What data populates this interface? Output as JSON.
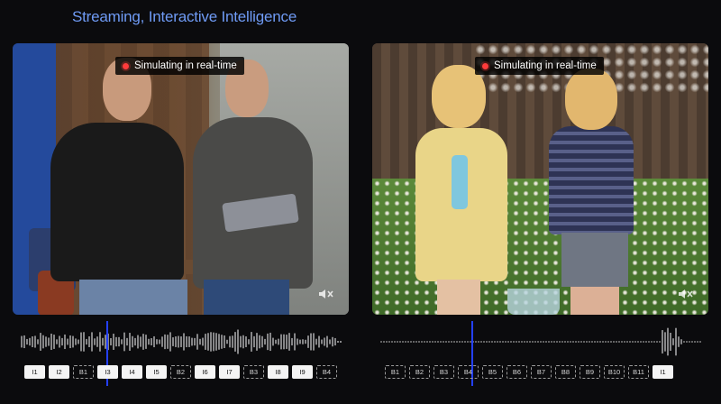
{
  "header": {
    "title": "Streaming, Interactive Intelligence"
  },
  "panels": [
    {
      "badge_text": "Simulating in real-time",
      "mute_icon": "speaker-muted-icon"
    },
    {
      "badge_text": "Simulating in real-time",
      "mute_icon": "speaker-muted-icon"
    }
  ],
  "timelines": [
    {
      "chips": [
        {
          "label": "I1",
          "kind": "input"
        },
        {
          "label": "I2",
          "kind": "input"
        },
        {
          "label": "B1",
          "kind": "buffer"
        },
        {
          "label": "I3",
          "kind": "input"
        },
        {
          "label": "I4",
          "kind": "input"
        },
        {
          "label": "I5",
          "kind": "input"
        },
        {
          "label": "B2",
          "kind": "buffer"
        },
        {
          "label": "I6",
          "kind": "input"
        },
        {
          "label": "I7",
          "kind": "input"
        },
        {
          "label": "B3",
          "kind": "buffer"
        },
        {
          "label": "I8",
          "kind": "input"
        },
        {
          "label": "I9",
          "kind": "input"
        },
        {
          "label": "B4",
          "kind": "buffer"
        }
      ]
    },
    {
      "chips": [
        {
          "label": "B1",
          "kind": "buffer"
        },
        {
          "label": "B2",
          "kind": "buffer"
        },
        {
          "label": "B3",
          "kind": "buffer"
        },
        {
          "label": "B4",
          "kind": "buffer"
        },
        {
          "label": "B5",
          "kind": "buffer"
        },
        {
          "label": "B6",
          "kind": "buffer"
        },
        {
          "label": "B7",
          "kind": "buffer"
        },
        {
          "label": "B8",
          "kind": "buffer"
        },
        {
          "label": "B9",
          "kind": "buffer"
        },
        {
          "label": "B10",
          "kind": "buffer"
        },
        {
          "label": "B11",
          "kind": "buffer"
        },
        {
          "label": "I1",
          "kind": "input"
        }
      ]
    }
  ],
  "colors": {
    "title": "#6f9bf5",
    "playhead": "#2440ff",
    "rec_dot": "#ff3b3b"
  }
}
